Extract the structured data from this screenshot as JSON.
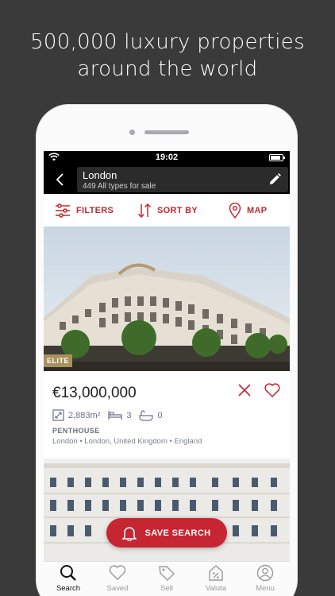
{
  "headline": {
    "line1": "500,000 luxury properties",
    "line2": "around the world"
  },
  "status": {
    "time": "19:02"
  },
  "search": {
    "city": "London",
    "count_text": "449 All types for sale"
  },
  "toolbar": {
    "filters": "FILTERS",
    "sort": "SORT BY",
    "map": "MAP"
  },
  "listing": {
    "badge": "ELITE",
    "price": "€13,000,000",
    "area": "2,883m²",
    "bedrooms": "3",
    "bathrooms": "0",
    "type": "PENTHOUSE",
    "location": "London • London, United Kingdom • England"
  },
  "save_search": "SAVE SEARCH",
  "tabs": [
    {
      "label": "Search",
      "icon": "search-icon"
    },
    {
      "label": "Saved",
      "icon": "heart-icon"
    },
    {
      "label": "Sell",
      "icon": "tag-icon"
    },
    {
      "label": "Valuta",
      "icon": "percent-icon"
    },
    {
      "label": "Menu",
      "icon": "user-icon"
    }
  ],
  "colors": {
    "accent": "#c62631",
    "background": "#3a3a3a",
    "badge": "#a8915c"
  }
}
